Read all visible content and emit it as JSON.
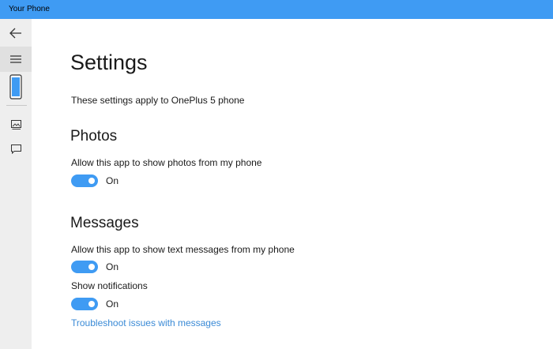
{
  "window": {
    "title": "Your Phone"
  },
  "sidebar": {
    "items": [
      {
        "icon": "back-arrow-icon"
      },
      {
        "icon": "hamburger-menu-icon"
      },
      {
        "icon": "phone-icon"
      },
      {
        "icon": "photos-icon"
      },
      {
        "icon": "messages-icon"
      }
    ]
  },
  "settings": {
    "title": "Settings",
    "description": "These settings apply to OnePlus 5 phone",
    "photos": {
      "heading": "Photos",
      "allow_label": "Allow this app to show photos from my phone",
      "allow_state": "On"
    },
    "messages": {
      "heading": "Messages",
      "allow_label": "Allow this app to show text messages from my phone",
      "allow_state": "On",
      "notifications_label": "Show notifications",
      "notifications_state": "On",
      "troubleshoot_link": "Troubleshoot issues with messages"
    }
  },
  "colors": {
    "accent": "#3f9bf3",
    "link": "#3a8ad6",
    "sidebar_bg": "#eeeeee"
  }
}
